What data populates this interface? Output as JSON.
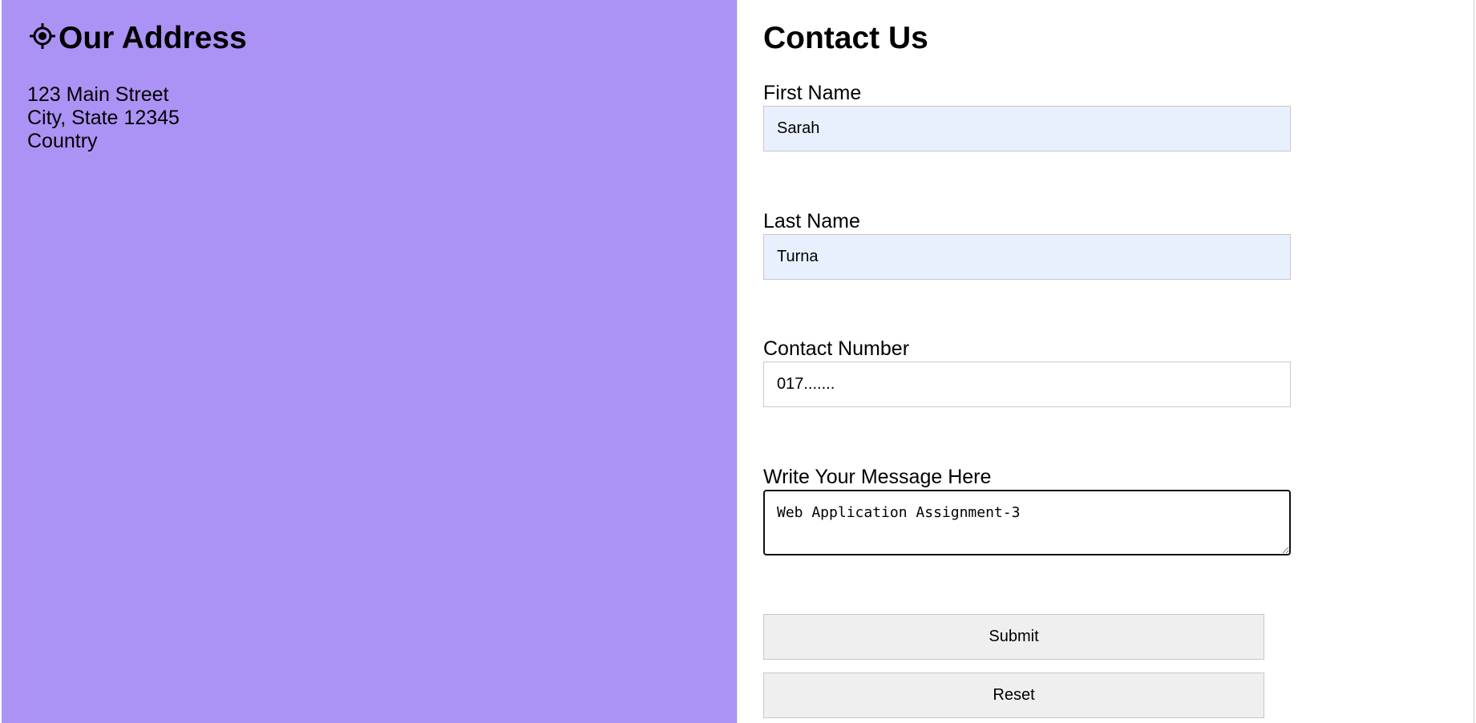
{
  "address_panel": {
    "icon": "location-crosshair-icon",
    "title": "Our Address",
    "lines": [
      "123 Main Street",
      "City, State 12345",
      "Country"
    ],
    "background_color": "#ab93f5"
  },
  "contact_form": {
    "title": "Contact Us",
    "first_name": {
      "label": "First Name",
      "value": "Sarah"
    },
    "last_name": {
      "label": "Last Name",
      "value": "Turna"
    },
    "contact_number": {
      "label": "Contact Number",
      "value": "017......."
    },
    "message": {
      "label": "Write Your Message Here",
      "value": "Web Application Assignment-3"
    },
    "submit_label": "Submit",
    "reset_label": "Reset",
    "autofill_color": "#e8f0fe"
  }
}
